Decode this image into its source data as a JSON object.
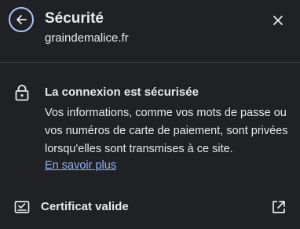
{
  "header": {
    "title": "Sécurité",
    "domain": "graindemalice.fr",
    "back_icon": "arrow-left-icon",
    "close_icon": "close-icon"
  },
  "connection": {
    "icon": "lock-icon",
    "title": "La connexion est sécurisée",
    "description": "Vos informations, comme vos mots de passe ou vos numéros de carte de paiement, sont privées lorsqu'elles sont transmises à ce site.",
    "learn_more": "En savoir plus"
  },
  "certificate": {
    "icon": "certificate-icon",
    "label": "Certificat valide",
    "external_icon": "open-external-icon"
  },
  "colors": {
    "background": "#202124",
    "text": "#e8eaed",
    "link": "#8ab4f8",
    "accent_ring": "#a8c7fa",
    "divider": "#3c4043"
  }
}
